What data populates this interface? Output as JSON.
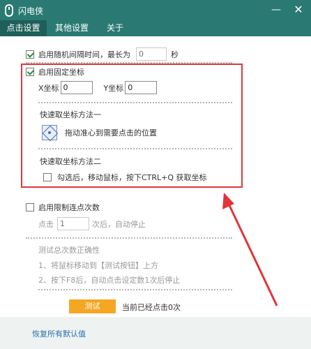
{
  "window": {
    "title": "闪电侠",
    "minimize": "—",
    "close": "✕"
  },
  "tabs": [
    {
      "label": "点击设置"
    },
    {
      "label": "其他设置"
    },
    {
      "label": "关于"
    }
  ],
  "random_interval": {
    "label": "启用随机间隔时间，最长为",
    "placeholder": "0",
    "unit": "秒",
    "checked": true
  },
  "fixed_coords": {
    "label": "启用固定坐标",
    "checked": true,
    "x_label": "X坐标",
    "x_value": "0",
    "y_label": "Y坐标",
    "y_value": "0",
    "method1_title": "快速取坐标方法一",
    "method1_text": "拖动准心到需要点击的位置",
    "method2_title": "快速取坐标方法二",
    "method2_text": "勾选后，移动鼠标，按下CTRL+Q 获取坐标",
    "method2_checked": false
  },
  "limit_clicks": {
    "label": "启用限制连点次数",
    "checked": false,
    "prefix": "点击",
    "placeholder": "1",
    "suffix": "次后，自动停止"
  },
  "test_info": {
    "title": "测试总次数正确性",
    "step1": "1、将鼠标移动到【测试按钮】上方",
    "step2": "2、按下F8后，自动点击设定数1次后停止"
  },
  "test_button": {
    "label": "测试"
  },
  "click_count": {
    "text": "当前已经点击0次"
  },
  "footer": {
    "restore_label": "恢复所有默认值"
  },
  "colors": {
    "titlebar": "#2a7a73",
    "highlight": "#e1353a",
    "test_button": "#f5a623",
    "link": "#2a6fb0"
  }
}
